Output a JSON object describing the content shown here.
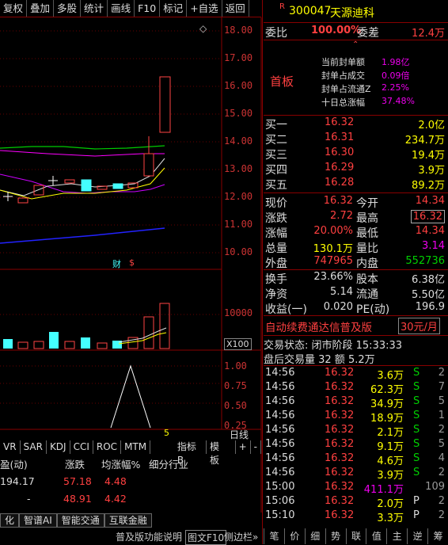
{
  "toolbar": [
    "复权",
    "叠加",
    "多股",
    "统计",
    "画线",
    "F10",
    "标记",
    "+自选",
    "返回"
  ],
  "chart": {
    "y_ticks": [
      "18.00",
      "17.00",
      "16.00",
      "15.00",
      "14.00",
      "13.00",
      "12.00",
      "11.00",
      "10.00"
    ],
    "vol_tick": "10000",
    "vol_unit": "X100",
    "ind_ticks": [
      "1.00",
      "0.75",
      "0.50",
      "0.25"
    ],
    "ind_bottom_label": "5",
    "day_label": "日线",
    "markers": [
      "财",
      "$"
    ]
  },
  "indicator_tabs": [
    "VR",
    "SAR",
    "KDJ",
    "CCI",
    "ROC",
    "MTM"
  ],
  "indicator_extra": [
    "指标B",
    "模 板",
    "+",
    "-"
  ],
  "table": {
    "headers": [
      "盈(动)",
      "涨跌",
      "均涨幅%",
      "细分行业"
    ],
    "rows": [
      [
        "194.17",
        "57.18",
        "4.48",
        ""
      ],
      [
        "-",
        "48.91",
        "4.42",
        ""
      ]
    ]
  },
  "bottom_tabs": [
    "化",
    "智谱AI",
    "智能交通",
    "互联金融"
  ],
  "bottom_status": [
    "普及版功能说明",
    "图文F10",
    "侧边栏»"
  ],
  "stock": {
    "badge": "R",
    "code": "300047",
    "name": "天源迪科"
  },
  "weibi": {
    "label1": "委比",
    "val1": "100.00%",
    "label2": "委差",
    "val2": "12.4万"
  },
  "first_board": {
    "label": "首板",
    "items": [
      {
        "k": "当前封单额",
        "v": "1.98亿"
      },
      {
        "k": "封单占成交",
        "v": "0.09倍"
      },
      {
        "k": "封单占流通Z",
        "v": "2.25%"
      },
      {
        "k": "十日总涨幅",
        "v": "37.48%"
      }
    ]
  },
  "bids": [
    {
      "l": "买一",
      "p": "16.32",
      "v": "2.0亿"
    },
    {
      "l": "买二",
      "p": "16.31",
      "v": "234.7万"
    },
    {
      "l": "买三",
      "p": "16.30",
      "v": "19.4万"
    },
    {
      "l": "买四",
      "p": "16.29",
      "v": "3.9万"
    },
    {
      "l": "买五",
      "p": "16.28",
      "v": "89.2万"
    }
  ],
  "quote": [
    {
      "l1": "现价",
      "v1": "16.32",
      "l2": "今开",
      "v2": "14.34"
    },
    {
      "l1": "涨跌",
      "v1": "2.72",
      "l2": "最高",
      "v2": "16.32"
    },
    {
      "l1": "涨幅",
      "v1": "20.00%",
      "l2": "最低",
      "v2": "14.34"
    },
    {
      "l1": "总量",
      "v1": "130.1万",
      "l2": "量比",
      "v2": "3.14"
    },
    {
      "l1": "外盘",
      "v1": "747965",
      "l2": "内盘",
      "v2": "552736"
    }
  ],
  "fund": [
    {
      "l1": "换手",
      "v1": "23.66%",
      "l2": "股本",
      "v2": "6.38亿"
    },
    {
      "l1": "净资",
      "v1": "5.14",
      "l2": "流通",
      "v2": "5.50亿"
    },
    {
      "l1": "收益(一)",
      "v1": "0.020",
      "l2": "PE(动)",
      "v2": "196.9"
    }
  ],
  "ad": {
    "text": "自动续费通达信普及版",
    "price": "30元/月"
  },
  "trade_status": {
    "text": "交易状态: 闭市阶段 15:33:33"
  },
  "after_hours": {
    "text": "盘后交易量 32 额 5.2万"
  },
  "ticks": [
    {
      "t": "14:56",
      "p": "16.32",
      "v": "3.6万",
      "s": "S",
      "n": "2"
    },
    {
      "t": "14:56",
      "p": "16.32",
      "v": "62.3万",
      "s": "S",
      "n": "7"
    },
    {
      "t": "14:56",
      "p": "16.32",
      "v": "34.9万",
      "s": "S",
      "n": "5"
    },
    {
      "t": "14:56",
      "p": "16.32",
      "v": "18.9万",
      "s": "S",
      "n": "1"
    },
    {
      "t": "14:56",
      "p": "16.32",
      "v": "2.1万",
      "s": "S",
      "n": "2"
    },
    {
      "t": "14:56",
      "p": "16.32",
      "v": "9.1万",
      "s": "S",
      "n": "5"
    },
    {
      "t": "14:56",
      "p": "16.32",
      "v": "4.6万",
      "s": "S",
      "n": "4"
    },
    {
      "t": "14:56",
      "p": "16.32",
      "v": "3.9万",
      "s": "S",
      "n": "2"
    },
    {
      "t": "15:00",
      "p": "16.32",
      "v": "411.1万",
      "s": "",
      "n": "109"
    },
    {
      "t": "15:06",
      "p": "16.32",
      "v": "2.0万",
      "s": "P",
      "n": "2"
    },
    {
      "t": "15:10",
      "p": "16.32",
      "v": "3.3万",
      "s": "P",
      "n": "2"
    }
  ],
  "right_tabs": [
    "笔",
    "价",
    "细",
    "势",
    "联",
    "值",
    "主",
    "逆",
    "筹"
  ]
}
